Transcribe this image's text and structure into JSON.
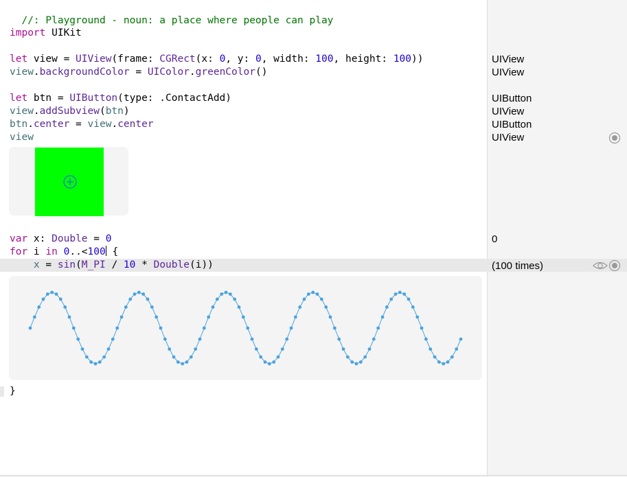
{
  "editor": {
    "lines": {
      "comment": "//: Playground - noun: a place where people can play",
      "import_kw": "import",
      "import_mod": " UIKit",
      "l1_let": "let",
      "l1_name": " view = ",
      "l1_type1": "UIView",
      "l1_a": "(frame: ",
      "l1_type2": "CGRect",
      "l1_b": "(x: ",
      "l1_n1": "0",
      "l1_c": ", y: ",
      "l1_n2": "0",
      "l1_d": ", width: ",
      "l1_n3": "100",
      "l1_e": ", height: ",
      "l1_n4": "100",
      "l1_f": "))",
      "l2_a": "view",
      "l2_b": ".",
      "l2_prop": "backgroundColor",
      "l2_c": " = ",
      "l2_type": "UIColor",
      "l2_d": ".",
      "l2_fn": "greenColor",
      "l2_e": "()",
      "l3_let": "let",
      "l3_a": " btn = ",
      "l3_type": "UIButton",
      "l3_b": "(type: .ContactAdd)",
      "l4_a": "view",
      "l4_b": ".",
      "l4_fn": "addSubview",
      "l4_c": "(",
      "l4_arg": "btn",
      "l4_d": ")",
      "l5_a": "btn",
      "l5_b": ".",
      "l5_prop": "center",
      "l5_c": " = ",
      "l5_d": "view",
      "l5_e": ".",
      "l5_prop2": "center",
      "l6": "view",
      "l7_kw": "var",
      "l7_a": " x: ",
      "l7_type": "Double",
      "l7_b": " = ",
      "l7_num": "0",
      "l8_kw": "for",
      "l8_a": " i ",
      "l8_kw2": "in",
      "l8_b": " ",
      "l8_num1": "0",
      "l8_c": "..<",
      "l8_num2": "100",
      "l8_d": " {",
      "l9_indent": "    ",
      "l9_a": "x",
      "l9_b": " = ",
      "l9_fn": "sin",
      "l9_c": "(",
      "l9_const": "M_PI",
      "l9_d": " / ",
      "l9_num": "10",
      "l9_e": " * ",
      "l9_type": "Double",
      "l9_f": "(i))",
      "l10": "}"
    }
  },
  "results": {
    "r_view1": "UIView",
    "r_view2": "UIView",
    "r_btn1": "UIButton",
    "r_view3": "UIView",
    "r_btn2": "UIButton",
    "r_view4": "UIView",
    "r_x": "0",
    "r_loop": "(100 times)"
  },
  "icons": {
    "quicklook": "quick-look-eye-icon",
    "result_toggle": "show-result-circle-icon"
  },
  "colors": {
    "keyword": "#aa0d91",
    "type": "#5c2699",
    "number": "#1c00cf",
    "comment": "#007400",
    "green_view": "#00ff00",
    "graph_line": "#4aa3df",
    "button_tint": "#1a6bd6"
  },
  "chart_data": {
    "type": "line",
    "title": "",
    "xlabel": "",
    "ylabel": "",
    "x_range": [
      0,
      99
    ],
    "ylim": [
      -1,
      1
    ],
    "series": [
      {
        "function": "sin(M_PI / 10 * Double(i))",
        "count": 100
      }
    ]
  }
}
